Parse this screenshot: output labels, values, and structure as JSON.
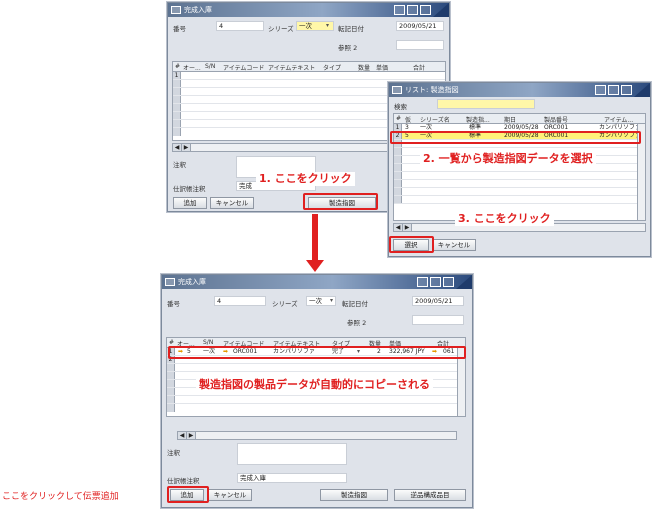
{
  "top_window": {
    "title": "完成入庫",
    "doc_no_label": "番号",
    "doc_no": "4",
    "series_label": "シリーズ",
    "series": "一次",
    "posting_date_label": "転記日付",
    "posting_date": "2009/05/21",
    "ref2_label": "参照 2",
    "columns": [
      "#",
      "オー...",
      "S/N",
      "アイテムコード",
      "アイテムテキスト",
      "タイプ",
      "数量",
      "単価",
      "合計"
    ],
    "rows": [
      "1",
      "",
      "",
      "",
      "",
      "",
      "",
      ""
    ],
    "remarks_label": "注釈",
    "journal_label": "仕訳帳注釈",
    "journal_value": "完成",
    "add_button": "追加",
    "cancel_button": "キャンセル",
    "production_order_button": "製造指図"
  },
  "list_window": {
    "title": "リスト: 製造指図",
    "search_label": "検索",
    "columns": [
      "#",
      "仮",
      "シリーズ名",
      "製造指...",
      "期日",
      "製品番号",
      "アイテム..."
    ],
    "rows": [
      {
        "no": "1",
        "key": "3",
        "series": "一次",
        "status": "標準",
        "date": "2009/05/28",
        "item": "ORC001",
        "text": "カンパリソファ"
      },
      {
        "no": "2",
        "key": "5",
        "series": "一次",
        "status": "標準",
        "date": "2009/05/28",
        "item": "ORC001",
        "text": "カンパリソファ"
      }
    ],
    "select_button": "選択",
    "cancel_button": "キャンセル"
  },
  "bottom_window": {
    "title": "完成入庫",
    "doc_no_label": "番号",
    "doc_no": "4",
    "series_label": "シリーズ",
    "series": "一次",
    "posting_date_label": "転記日付",
    "posting_date": "2009/05/21",
    "ref2_label": "参照 2",
    "columns": [
      "#",
      "オー...",
      "S/N",
      "アイテムコード",
      "アイテムテキスト",
      "タイプ",
      "数量",
      "単価",
      "合計"
    ],
    "row1": {
      "no": "1",
      "order": "5",
      "series": "一次",
      "item": "ORC001",
      "text": "カンパリソファ",
      "type": "完了",
      "qty": "2",
      "price": "322,967 JPY",
      "total": "061"
    },
    "row2_no": "2",
    "remarks_label": "注釈",
    "journal_label": "仕訳帳注釈",
    "journal_value": "完成入庫",
    "add_button": "追加",
    "cancel_button": "キャンセル",
    "production_order_button": "製造指図",
    "finished_goods_button": "逆品構成品目"
  },
  "annotations": {
    "step1": "1. ここをクリック",
    "step2": "2. 一覧から製造指図データを選択",
    "step3": "3. ここをクリック",
    "auto_copy": "製造指図の製品データが自動的にコピーされる",
    "add_note": "ここをクリックして伝票追加"
  },
  "colors": {
    "accent_red": "#e02020",
    "title_blue": "#5d7391",
    "highlight_yellow": "#fff27a"
  }
}
